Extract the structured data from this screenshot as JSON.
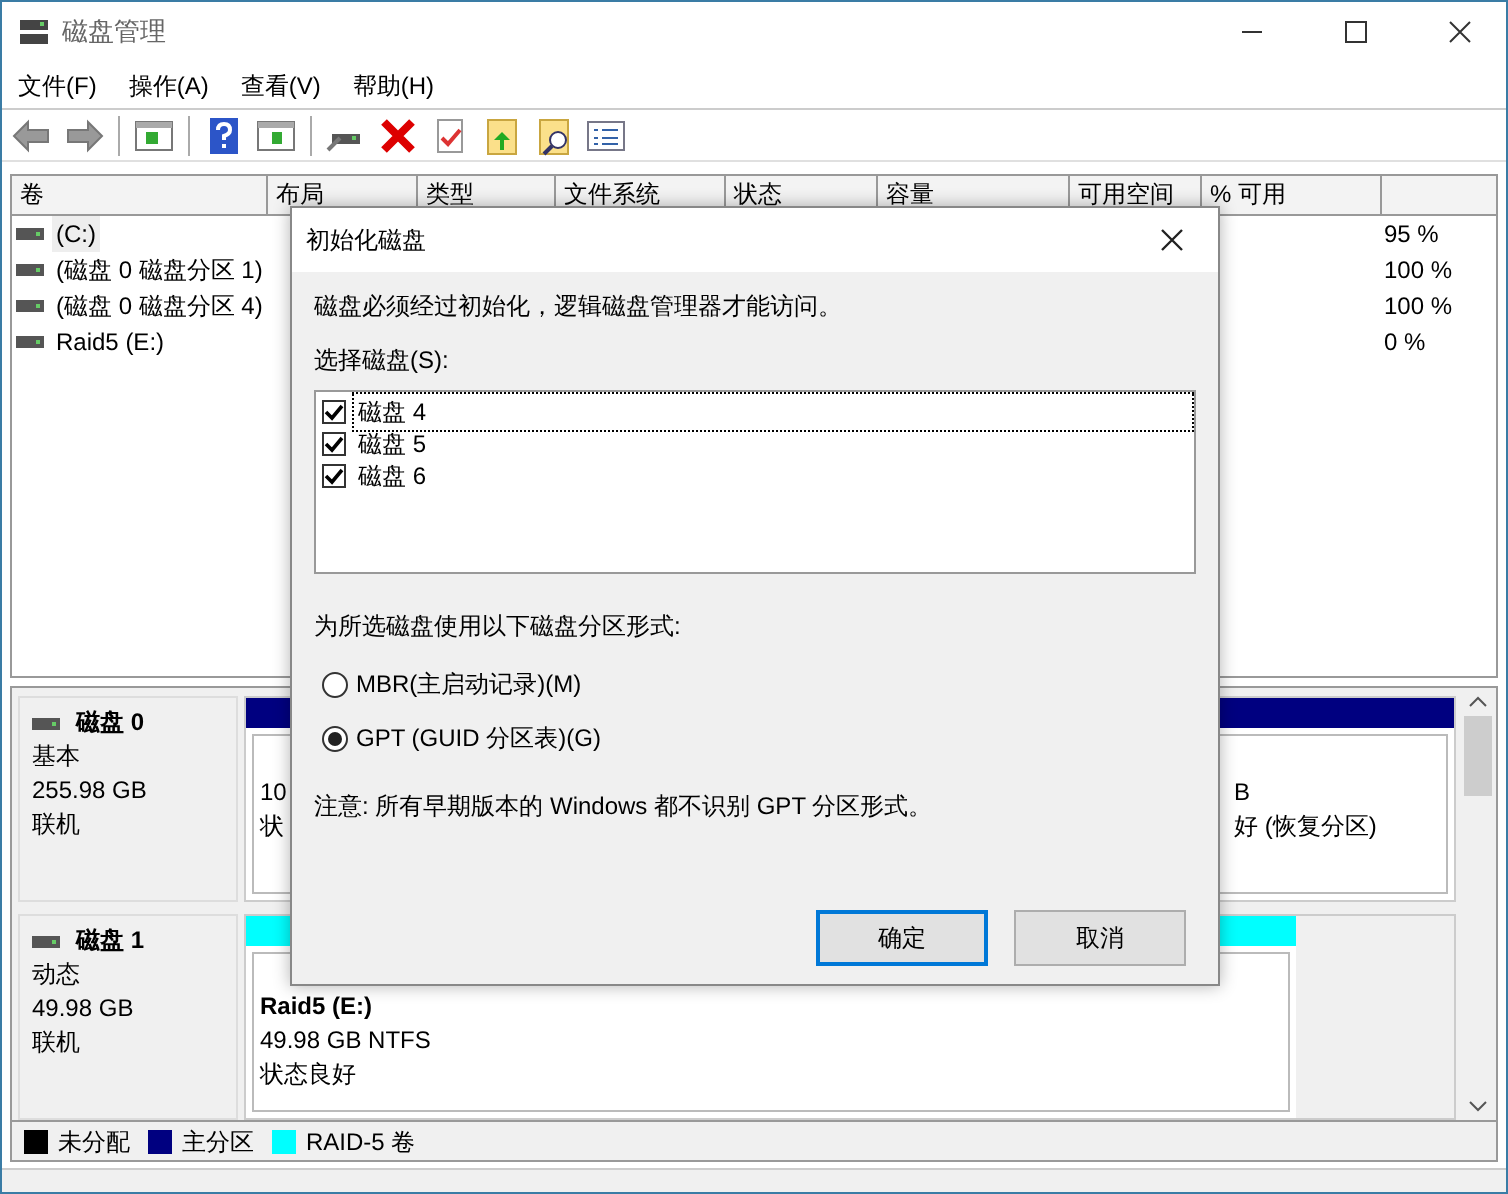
{
  "window": {
    "title": "磁盘管理"
  },
  "menu": [
    {
      "label": "文件(F)"
    },
    {
      "label": "操作(A)"
    },
    {
      "label": "查看(V)"
    },
    {
      "label": "帮助(H)"
    }
  ],
  "volume_table": {
    "columns": [
      "卷",
      "布局",
      "类型",
      "文件系统",
      "状态",
      "容量",
      "可用空间",
      "% 可用"
    ],
    "rows": [
      {
        "volume": "(C:)",
        "percent_free": "95 %",
        "selected": true
      },
      {
        "volume": "(磁盘 0 磁盘分区 1)",
        "percent_free": "100 %",
        "selected": false
      },
      {
        "volume": "(磁盘 0 磁盘分区 4)",
        "percent_free": "100 %",
        "selected": false
      },
      {
        "volume": "Raid5 (E:)",
        "percent_free": "0 %",
        "selected": false
      }
    ]
  },
  "disks": [
    {
      "name": "磁盘 0",
      "type": "基本",
      "size": "255.98 GB",
      "status": "联机",
      "partitions": [
        {
          "color": "#000080",
          "lines": [
            "10",
            "状"
          ]
        },
        {
          "color": "#000080",
          "lines": [
            "B",
            "好 (恢复分区)"
          ]
        }
      ]
    },
    {
      "name": "磁盘 1",
      "type": "动态",
      "size": "49.98 GB",
      "status": "联机",
      "partitions": [
        {
          "color": "#00ffff",
          "title": "Raid5 (E:)",
          "lines": [
            "49.98 GB NTFS",
            "状态良好"
          ]
        }
      ]
    }
  ],
  "legend": [
    {
      "label": "未分配",
      "color": "#000000"
    },
    {
      "label": "主分区",
      "color": "#000080"
    },
    {
      "label": "RAID-5 卷",
      "color": "#00ffff"
    }
  ],
  "dialog": {
    "title": "初始化磁盘",
    "message": "磁盘必须经过初始化，逻辑磁盘管理器才能访问。",
    "select_label": "选择磁盘(S):",
    "disks": [
      {
        "label": "磁盘 4",
        "checked": true,
        "focused": true
      },
      {
        "label": "磁盘 5",
        "checked": true,
        "focused": false
      },
      {
        "label": "磁盘 6",
        "checked": true,
        "focused": false
      }
    ],
    "style_label": "为所选磁盘使用以下磁盘分区形式:",
    "options": [
      {
        "label": "MBR(主启动记录)(M)",
        "selected": false
      },
      {
        "label": "GPT (GUID 分区表)(G)",
        "selected": true
      }
    ],
    "note": "注意: 所有早期版本的 Windows 都不识别 GPT 分区形式。",
    "buttons": [
      {
        "label": "确定",
        "default": true
      },
      {
        "label": "取消",
        "default": false
      }
    ]
  }
}
